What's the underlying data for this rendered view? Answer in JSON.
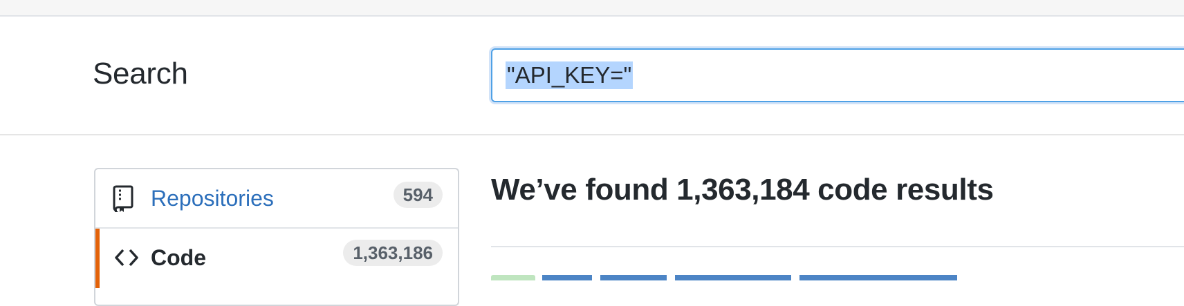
{
  "search": {
    "heading": "Search",
    "query": "\"API_KEY=\""
  },
  "sidebar": {
    "items": [
      {
        "label": "Repositories",
        "count": "594",
        "icon": "repo-icon",
        "selected": false
      },
      {
        "label": "Code",
        "count": "1,363,186",
        "icon": "code-icon",
        "selected": true
      }
    ]
  },
  "results": {
    "heading": "We’ve found 1,363,184 code results"
  },
  "colors": {
    "link": "#2c6fbb",
    "selected_accent": "#e36209",
    "focus_border": "#4fa1e6",
    "text_selection": "#b4d5fe"
  }
}
